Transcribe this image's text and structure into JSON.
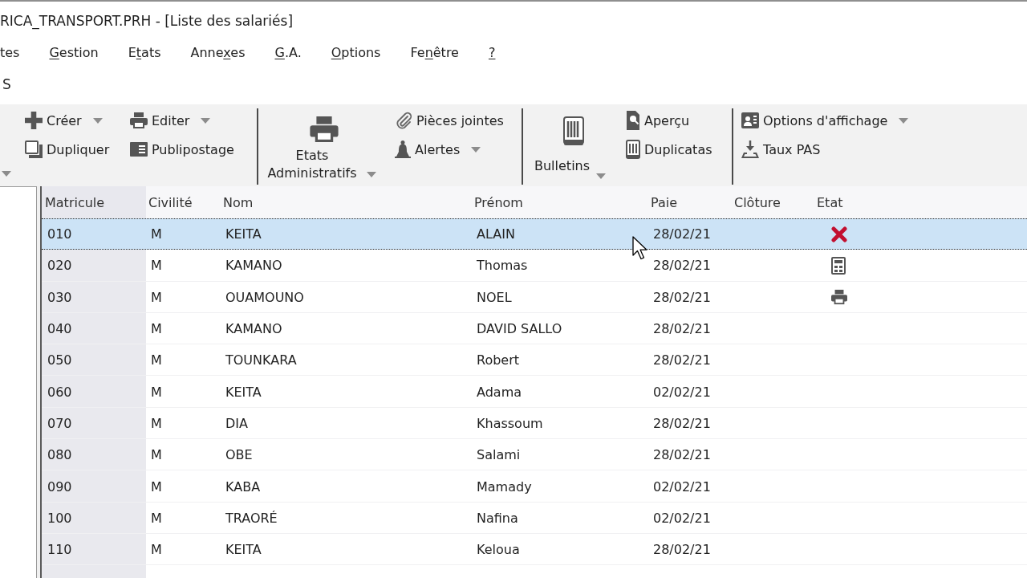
{
  "window": {
    "title": "RICA_TRANSPORT.PRH - [Liste des salariés]"
  },
  "menu": [
    {
      "post": "tes"
    },
    {
      "key": "G",
      "post": "estion"
    },
    {
      "pre": "E",
      "key": "t",
      "post": "ats"
    },
    {
      "pre": "Anne",
      "key": "x",
      "post": "es"
    },
    {
      "key": "G",
      "post": ".A."
    },
    {
      "key": "O",
      "post": "ptions"
    },
    {
      "pre": "Fe",
      "key": "n",
      "post": "être"
    },
    {
      "key": "?"
    }
  ],
  "section_title": "S",
  "ribbon": {
    "groups": [
      {
        "buttons": [
          {
            "kind": "small",
            "label": "Créer",
            "dropdown": true
          },
          {
            "kind": "small",
            "label": "Dupliquer",
            "dropdown": false
          },
          {
            "kind": "small",
            "label": "Editer",
            "dropdown": true
          },
          {
            "kind": "small",
            "label": "Publipostage",
            "dropdown": false
          }
        ]
      },
      {
        "buttons": [
          {
            "kind": "large",
            "label": "Etats Administratifs",
            "dropdown": true
          },
          {
            "kind": "small",
            "label": "Pièces jointes",
            "dropdown": false
          },
          {
            "kind": "small",
            "label": "Alertes",
            "dropdown": true
          }
        ]
      },
      {
        "buttons": [
          {
            "kind": "large",
            "label": "Bulletins",
            "dropdown": true
          },
          {
            "kind": "small",
            "label": "Aperçu",
            "dropdown": false
          },
          {
            "kind": "small",
            "label": "Duplicatas",
            "dropdown": false
          }
        ]
      },
      {
        "buttons": [
          {
            "kind": "small",
            "label": "Options d'affichage",
            "dropdown": true
          },
          {
            "kind": "small",
            "label": "Taux PAS",
            "dropdown": false
          }
        ]
      }
    ]
  },
  "table": {
    "columns": [
      "Matricule",
      "Civilité",
      "Nom",
      "Prénom",
      "Paie",
      "Clôture",
      "Etat"
    ],
    "rows": [
      {
        "matricule": "010",
        "civilite": "M",
        "nom": "KEITA",
        "prenom": "ALAIN",
        "paie": "28/02/21",
        "etat": {
          "kind": "error"
        },
        "selected": true
      },
      {
        "matricule": "020",
        "civilite": "M",
        "nom": "KAMANO",
        "prenom": "Thomas",
        "paie": "28/02/21",
        "etat": {
          "kind": "calculated"
        },
        "selected": false
      },
      {
        "matricule": "030",
        "civilite": "M",
        "nom": "OUAMOUNO",
        "prenom": "NOEL",
        "paie": "28/02/21",
        "etat": {
          "kind": "printed"
        },
        "selected": false
      },
      {
        "matricule": "040",
        "civilite": "M",
        "nom": "KAMANO",
        "prenom": "DAVID SALLO",
        "paie": "28/02/21",
        "selected": false
      },
      {
        "matricule": "050",
        "civilite": "M",
        "nom": "TOUNKARA",
        "prenom": "Robert",
        "paie": "28/02/21",
        "selected": false
      },
      {
        "matricule": "060",
        "civilite": "M",
        "nom": "KEITA",
        "prenom": "Adama",
        "paie": "02/02/21",
        "selected": false
      },
      {
        "matricule": "070",
        "civilite": "M",
        "nom": "DIA",
        "prenom": "Khassoum",
        "paie": "28/02/21",
        "selected": false
      },
      {
        "matricule": "080",
        "civilite": "M",
        "nom": "OBE",
        "prenom": "Salami",
        "paie": "28/02/21",
        "selected": false
      },
      {
        "matricule": "090",
        "civilite": "M",
        "nom": "KABA",
        "prenom": "Mamady",
        "paie": "02/02/21",
        "selected": false
      },
      {
        "matricule": "100",
        "civilite": "M",
        "nom": "TRAORÉ",
        "prenom": "Nafina",
        "paie": "02/02/21",
        "selected": false
      },
      {
        "matricule": "110",
        "civilite": "M",
        "nom": "KEITA",
        "prenom": "Keloua",
        "paie": "28/02/21",
        "selected": false
      }
    ]
  }
}
